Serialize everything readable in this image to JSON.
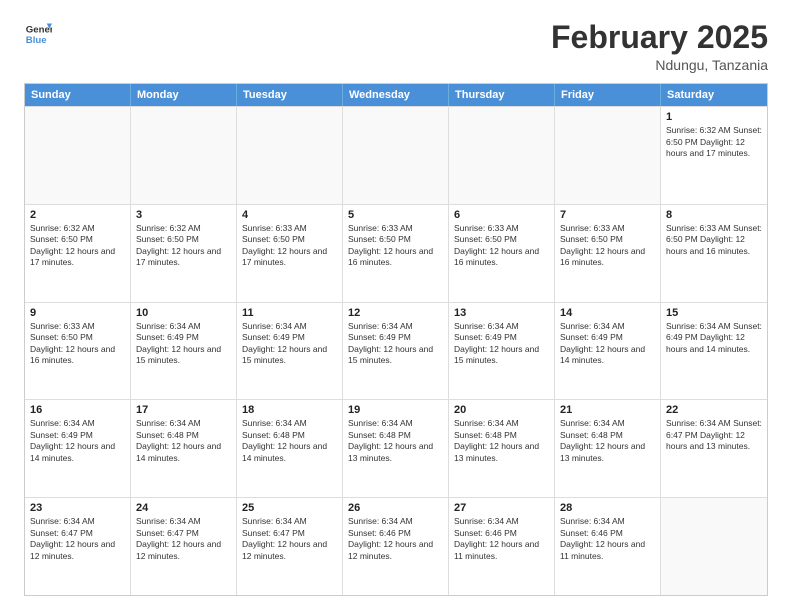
{
  "logo": {
    "line1": "General",
    "line2": "Blue"
  },
  "header": {
    "month_year": "February 2025",
    "location": "Ndungu, Tanzania"
  },
  "weekdays": [
    "Sunday",
    "Monday",
    "Tuesday",
    "Wednesday",
    "Thursday",
    "Friday",
    "Saturday"
  ],
  "rows": [
    [
      {
        "day": "",
        "text": ""
      },
      {
        "day": "",
        "text": ""
      },
      {
        "day": "",
        "text": ""
      },
      {
        "day": "",
        "text": ""
      },
      {
        "day": "",
        "text": ""
      },
      {
        "day": "",
        "text": ""
      },
      {
        "day": "1",
        "text": "Sunrise: 6:32 AM\nSunset: 6:50 PM\nDaylight: 12 hours\nand 17 minutes."
      }
    ],
    [
      {
        "day": "2",
        "text": "Sunrise: 6:32 AM\nSunset: 6:50 PM\nDaylight: 12 hours\nand 17 minutes."
      },
      {
        "day": "3",
        "text": "Sunrise: 6:32 AM\nSunset: 6:50 PM\nDaylight: 12 hours\nand 17 minutes."
      },
      {
        "day": "4",
        "text": "Sunrise: 6:33 AM\nSunset: 6:50 PM\nDaylight: 12 hours\nand 17 minutes."
      },
      {
        "day": "5",
        "text": "Sunrise: 6:33 AM\nSunset: 6:50 PM\nDaylight: 12 hours\nand 16 minutes."
      },
      {
        "day": "6",
        "text": "Sunrise: 6:33 AM\nSunset: 6:50 PM\nDaylight: 12 hours\nand 16 minutes."
      },
      {
        "day": "7",
        "text": "Sunrise: 6:33 AM\nSunset: 6:50 PM\nDaylight: 12 hours\nand 16 minutes."
      },
      {
        "day": "8",
        "text": "Sunrise: 6:33 AM\nSunset: 6:50 PM\nDaylight: 12 hours\nand 16 minutes."
      }
    ],
    [
      {
        "day": "9",
        "text": "Sunrise: 6:33 AM\nSunset: 6:50 PM\nDaylight: 12 hours\nand 16 minutes."
      },
      {
        "day": "10",
        "text": "Sunrise: 6:34 AM\nSunset: 6:49 PM\nDaylight: 12 hours\nand 15 minutes."
      },
      {
        "day": "11",
        "text": "Sunrise: 6:34 AM\nSunset: 6:49 PM\nDaylight: 12 hours\nand 15 minutes."
      },
      {
        "day": "12",
        "text": "Sunrise: 6:34 AM\nSunset: 6:49 PM\nDaylight: 12 hours\nand 15 minutes."
      },
      {
        "day": "13",
        "text": "Sunrise: 6:34 AM\nSunset: 6:49 PM\nDaylight: 12 hours\nand 15 minutes."
      },
      {
        "day": "14",
        "text": "Sunrise: 6:34 AM\nSunset: 6:49 PM\nDaylight: 12 hours\nand 14 minutes."
      },
      {
        "day": "15",
        "text": "Sunrise: 6:34 AM\nSunset: 6:49 PM\nDaylight: 12 hours\nand 14 minutes."
      }
    ],
    [
      {
        "day": "16",
        "text": "Sunrise: 6:34 AM\nSunset: 6:49 PM\nDaylight: 12 hours\nand 14 minutes."
      },
      {
        "day": "17",
        "text": "Sunrise: 6:34 AM\nSunset: 6:48 PM\nDaylight: 12 hours\nand 14 minutes."
      },
      {
        "day": "18",
        "text": "Sunrise: 6:34 AM\nSunset: 6:48 PM\nDaylight: 12 hours\nand 14 minutes."
      },
      {
        "day": "19",
        "text": "Sunrise: 6:34 AM\nSunset: 6:48 PM\nDaylight: 12 hours\nand 13 minutes."
      },
      {
        "day": "20",
        "text": "Sunrise: 6:34 AM\nSunset: 6:48 PM\nDaylight: 12 hours\nand 13 minutes."
      },
      {
        "day": "21",
        "text": "Sunrise: 6:34 AM\nSunset: 6:48 PM\nDaylight: 12 hours\nand 13 minutes."
      },
      {
        "day": "22",
        "text": "Sunrise: 6:34 AM\nSunset: 6:47 PM\nDaylight: 12 hours\nand 13 minutes."
      }
    ],
    [
      {
        "day": "23",
        "text": "Sunrise: 6:34 AM\nSunset: 6:47 PM\nDaylight: 12 hours\nand 12 minutes."
      },
      {
        "day": "24",
        "text": "Sunrise: 6:34 AM\nSunset: 6:47 PM\nDaylight: 12 hours\nand 12 minutes."
      },
      {
        "day": "25",
        "text": "Sunrise: 6:34 AM\nSunset: 6:47 PM\nDaylight: 12 hours\nand 12 minutes."
      },
      {
        "day": "26",
        "text": "Sunrise: 6:34 AM\nSunset: 6:46 PM\nDaylight: 12 hours\nand 12 minutes."
      },
      {
        "day": "27",
        "text": "Sunrise: 6:34 AM\nSunset: 6:46 PM\nDaylight: 12 hours\nand 11 minutes."
      },
      {
        "day": "28",
        "text": "Sunrise: 6:34 AM\nSunset: 6:46 PM\nDaylight: 12 hours\nand 11 minutes."
      },
      {
        "day": "",
        "text": ""
      }
    ]
  ]
}
